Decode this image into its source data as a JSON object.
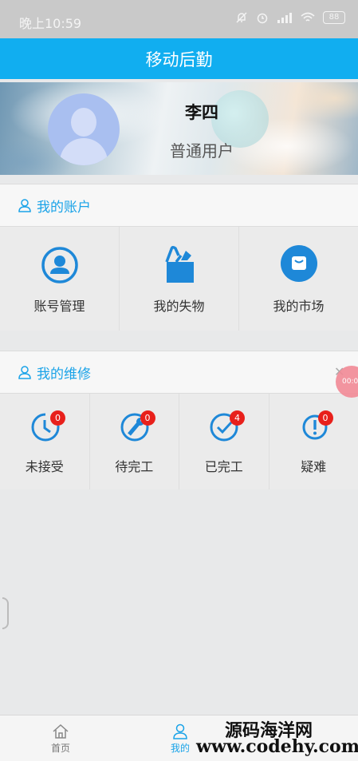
{
  "status_bar": {
    "time": "晚上10:59",
    "battery": "88"
  },
  "app_bar": {
    "title": "移动后勤"
  },
  "profile": {
    "name": "李四",
    "role": "普通用户"
  },
  "account_section": {
    "title": "我的账户",
    "items": [
      {
        "label": "账号管理",
        "icon": "user-circle-icon"
      },
      {
        "label": "我的失物",
        "icon": "lost-box-icon"
      },
      {
        "label": "我的市场",
        "icon": "shopping-bag-icon"
      }
    ]
  },
  "repair_section": {
    "title": "我的维修",
    "items": [
      {
        "label": "未接受",
        "badge": "0",
        "icon": "clock-icon"
      },
      {
        "label": "待完工",
        "badge": "0",
        "icon": "wrench-icon"
      },
      {
        "label": "已完工",
        "badge": "4",
        "icon": "check-circle-icon"
      },
      {
        "label": "疑难",
        "badge": "0",
        "icon": "exclamation-circle-icon"
      }
    ]
  },
  "floating": {
    "timer": "00:0"
  },
  "tabs": [
    {
      "label": "首页",
      "icon": "home-icon"
    },
    {
      "label": "我的",
      "icon": "person-icon"
    }
  ],
  "watermark": {
    "site_name": "源码海洋网",
    "url": "www.codehy.com"
  },
  "colors": {
    "accent": "#11aef0",
    "badge": "#e8201b",
    "icon_blue": "#1e88d8"
  }
}
